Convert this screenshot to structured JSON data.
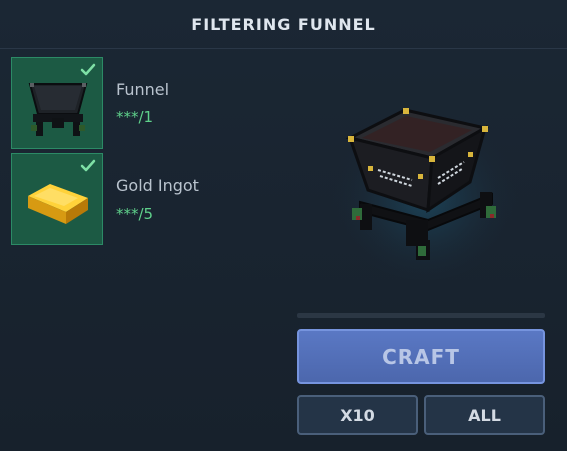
{
  "window": {
    "title": "FILTERING FUNNEL"
  },
  "ingredients": [
    {
      "name": "Funnel",
      "count": "***/1",
      "icon": "funnel-icon",
      "checked": true
    },
    {
      "name": "Gold Ingot",
      "count": "***/5",
      "icon": "gold-ingot-icon",
      "checked": true
    }
  ],
  "preview": {
    "icon": "filtering-funnel-icon"
  },
  "progress": {
    "value": 0
  },
  "actions": {
    "craft_label": "CRAFT",
    "x10_label": "X10",
    "all_label": "ALL"
  },
  "colors": {
    "background": "#18232f",
    "slot_complete": "#1c5a44",
    "count_ok": "#5fd18b",
    "craft_button": "#5a78c4"
  }
}
